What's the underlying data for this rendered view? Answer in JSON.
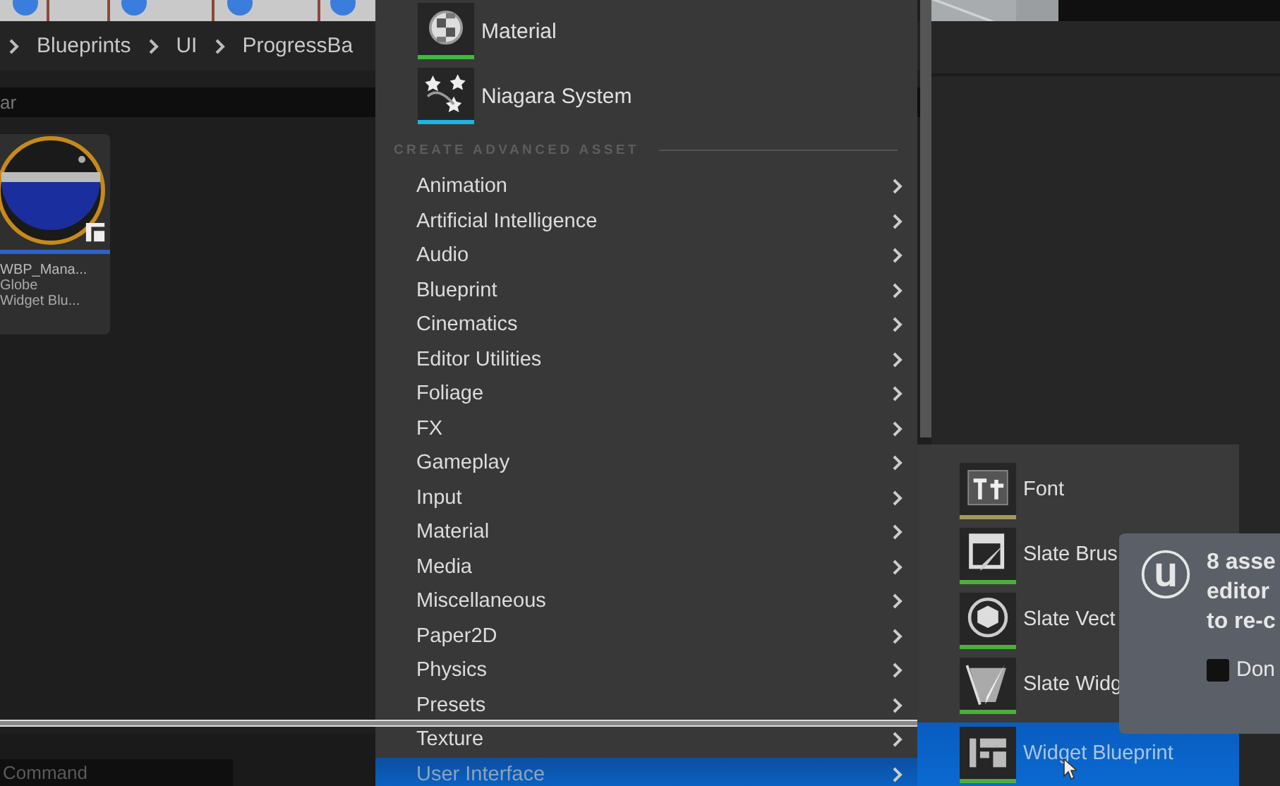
{
  "breadcrumb": [
    {
      "label": "Blueprints"
    },
    {
      "label": "UI"
    },
    {
      "label": "ProgressBa"
    }
  ],
  "search": {
    "value": "ar"
  },
  "asset": {
    "name": "WBP_Mana...",
    "subtitle": "Globe",
    "type": "Widget Blu..."
  },
  "menu": {
    "common": [
      {
        "label": "Material",
        "kind": "material",
        "color": "#3fb93f"
      },
      {
        "label": "Niagara System",
        "kind": "niagara",
        "color": "#1fb3e0"
      }
    ],
    "section": "CREATE ADVANCED ASSET",
    "categories": [
      {
        "label": "Animation",
        "selected": false
      },
      {
        "label": "Artificial Intelligence",
        "selected": false
      },
      {
        "label": "Audio",
        "selected": false
      },
      {
        "label": "Blueprint",
        "selected": false
      },
      {
        "label": "Cinematics",
        "selected": false
      },
      {
        "label": "Editor Utilities",
        "selected": false
      },
      {
        "label": "Foliage",
        "selected": false
      },
      {
        "label": "FX",
        "selected": false
      },
      {
        "label": "Gameplay",
        "selected": false
      },
      {
        "label": "Input",
        "selected": false
      },
      {
        "label": "Material",
        "selected": false
      },
      {
        "label": "Media",
        "selected": false
      },
      {
        "label": "Miscellaneous",
        "selected": false
      },
      {
        "label": "Paper2D",
        "selected": false
      },
      {
        "label": "Physics",
        "selected": false
      },
      {
        "label": "Presets",
        "selected": false
      },
      {
        "label": "Texture",
        "selected": false
      },
      {
        "label": "User Interface",
        "selected": true
      }
    ]
  },
  "submenu": [
    {
      "label": "Font",
      "kind": "font",
      "color": "#a39a5a",
      "selected": false
    },
    {
      "label": "Slate Brus",
      "kind": "brush",
      "color": "#4caf3a",
      "selected": false
    },
    {
      "label": "Slate Vect",
      "kind": "vector",
      "color": "#4caf3a",
      "selected": false
    },
    {
      "label": "Slate Widg",
      "kind": "style",
      "color": "#4caf3a",
      "selected": false
    },
    {
      "label": "Widget Blueprint",
      "kind": "blueprint",
      "color": "#4caf3a",
      "selected": true
    }
  ],
  "toast": {
    "lines": [
      "8 asse",
      "editor",
      "to re-c"
    ],
    "checkbox": {
      "label": "Don",
      "checked": false
    }
  },
  "command": {
    "placeholder": "Command"
  }
}
